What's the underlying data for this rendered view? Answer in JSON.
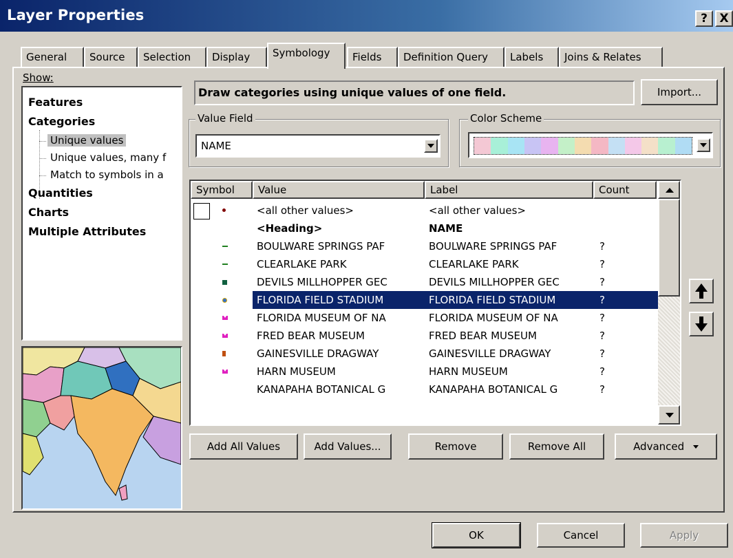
{
  "window": {
    "title": "Layer Properties",
    "help_btn": "?",
    "close_btn": "X"
  },
  "tabs": [
    "General",
    "Source",
    "Selection",
    "Display",
    "Symbology",
    "Fields",
    "Definition Query",
    "Labels",
    "Joins & Relates"
  ],
  "show": {
    "label": "Show:",
    "items": [
      "Features",
      "Categories",
      "Unique values",
      "Unique values, many f",
      "Match to symbols in a",
      "Quantities",
      "Charts",
      "Multiple Attributes"
    ]
  },
  "description": "Draw categories using unique values of one field.",
  "import_button": "Import...",
  "value_field": {
    "label": "Value Field",
    "value": "NAME"
  },
  "color_scheme": {
    "label": "Color Scheme",
    "swatches": [
      "#f4c8d4",
      "#a8f0d8",
      "#a8e4f4",
      "#c8c4f4",
      "#e8b4f0",
      "#c4f0c8",
      "#f4dcb0",
      "#f4b8c4",
      "#c4e0f4",
      "#f4c8e8",
      "#f4e0c8",
      "#b8f0d0",
      "#b0dcf4"
    ]
  },
  "table": {
    "headers": [
      "Symbol",
      "Value",
      "Label",
      "Count"
    ],
    "rows": [
      {
        "value": "<all other values>",
        "label": "<all other values>",
        "count": "",
        "symbol": "dot",
        "color": "#800000"
      },
      {
        "value": "<Heading>",
        "label": "NAME",
        "count": "",
        "symbol": "none",
        "color": "",
        "heading": true
      },
      {
        "value": "BOULWARE SPRINGS PAF",
        "label": "BOULWARE SPRINGS PAF",
        "count": "?",
        "symbol": "dash",
        "color": "#208020"
      },
      {
        "value": "CLEARLAKE PARK",
        "label": "CLEARLAKE PARK",
        "count": "?",
        "symbol": "dash",
        "color": "#208020"
      },
      {
        "value": "DEVILS MILLHOPPER GEC",
        "label": "DEVILS MILLHOPPER GEC",
        "count": "?",
        "symbol": "square",
        "color": "#106040"
      },
      {
        "value": "FLORIDA FIELD STADIUM",
        "label": "FLORIDA FIELD STADIUM",
        "count": "?",
        "symbol": "round",
        "color": "#3070d0",
        "selected": true
      },
      {
        "value": "FLORIDA MUSEUM OF NA",
        "label": "FLORIDA MUSEUM OF NA",
        "count": "?",
        "symbol": "m",
        "color": "#e020c0"
      },
      {
        "value": "FRED BEAR MUSEUM",
        "label": "FRED BEAR MUSEUM",
        "count": "?",
        "symbol": "m",
        "color": "#e020c0"
      },
      {
        "value": "GAINESVILLE DRAGWAY",
        "label": "GAINESVILLE DRAGWAY",
        "count": "?",
        "symbol": "flag",
        "color": "#c05010"
      },
      {
        "value": "HARN MUSEUM",
        "label": "HARN MUSEUM",
        "count": "?",
        "symbol": "m",
        "color": "#e020c0"
      },
      {
        "value": "KANAPAHA BOTANICAL G",
        "label": "KANAPAHA BOTANICAL G",
        "count": "?",
        "symbol": "none",
        "color": ""
      }
    ]
  },
  "list_buttons": {
    "add_all": "Add All Values",
    "add_values": "Add Values...",
    "remove": "Remove",
    "remove_all": "Remove All",
    "advanced": "Advanced"
  },
  "dialog_buttons": {
    "ok": "OK",
    "cancel": "Cancel",
    "apply": "Apply"
  }
}
